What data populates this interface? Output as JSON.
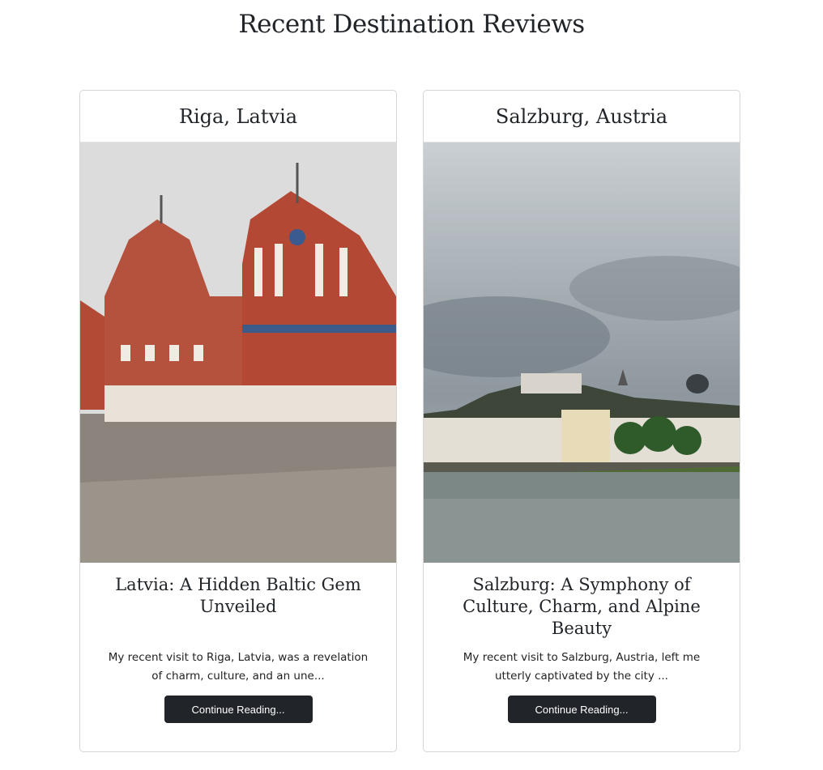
{
  "page": {
    "title": "Recent Destination Reviews"
  },
  "cards": [
    {
      "location": "Riga, Latvia",
      "title": "Latvia: A Hidden Baltic Gem Unveiled",
      "excerpt": "My recent visit to Riga, Latvia, was a revelation of charm, culture, and an une...",
      "button": "Continue Reading..."
    },
    {
      "location": "Salzburg, Austria",
      "title": "Salzburg: A Symphony of Culture, Charm, and Alpine Beauty",
      "excerpt": "My recent visit to Salzburg, Austria, left me utterly captivated by the city  ...",
      "button": "Continue Reading..."
    }
  ],
  "colors": {
    "button": "#212529",
    "border": "#d6d6d6"
  }
}
